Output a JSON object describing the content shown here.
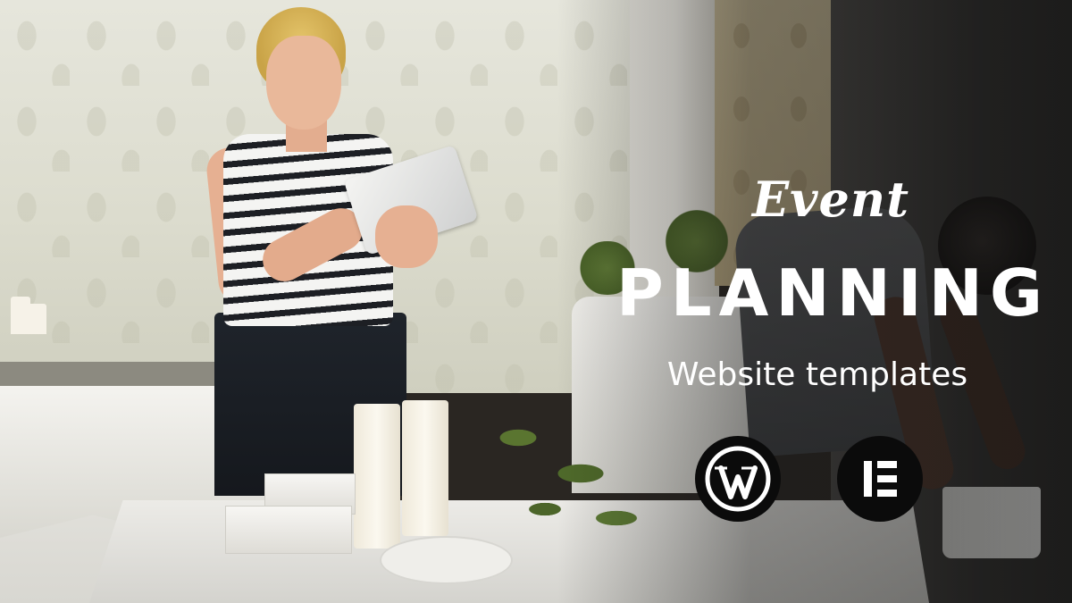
{
  "banner": {
    "script_word": "Event",
    "headline": "PLANNING",
    "subtitle": "Website templates"
  },
  "logos": [
    {
      "icon": "wordpress-logo-icon",
      "letter": "W"
    },
    {
      "icon": "elementor-logo-icon",
      "letter": "E"
    }
  ],
  "colors": {
    "text": "#ffffff",
    "logo_badge": "#0b0b0b",
    "stripe_dark": "#1d1f24",
    "hair": "#e4c46a"
  }
}
